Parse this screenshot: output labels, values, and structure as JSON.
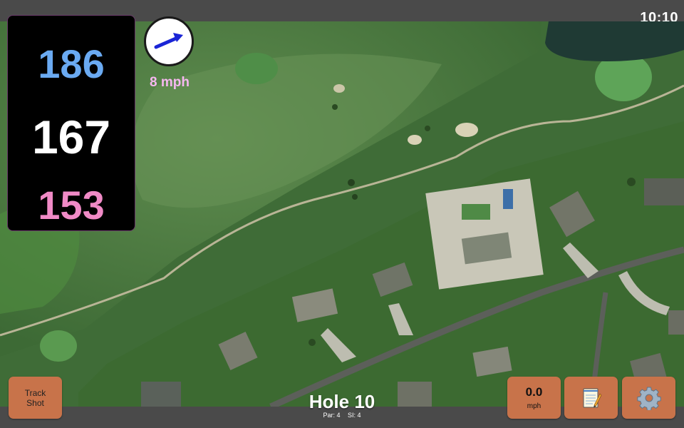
{
  "status_bar": {
    "time": "10:10"
  },
  "distances": {
    "back": "186",
    "center": "167",
    "front": "153"
  },
  "distance_colors": {
    "back": "#6aaaf2",
    "center": "#ffffff",
    "front": "#f08ac6"
  },
  "wind": {
    "speed_label": "8 mph",
    "direction_icon": "wind-arrow-icon"
  },
  "buttons": {
    "track_shot_line1": "Track",
    "track_shot_line2": "Shot",
    "wind_value": "0.0",
    "wind_unit": "mph",
    "notes_icon": "notepad-icon",
    "settings_icon": "gear-icon"
  },
  "hole": {
    "title": "Hole 10",
    "par": "Par: 4",
    "si": "SI: 4"
  },
  "colors": {
    "button_bg": "#c8734a",
    "panel_bg": "#000000",
    "bar_bg": "#4a4a4a"
  }
}
